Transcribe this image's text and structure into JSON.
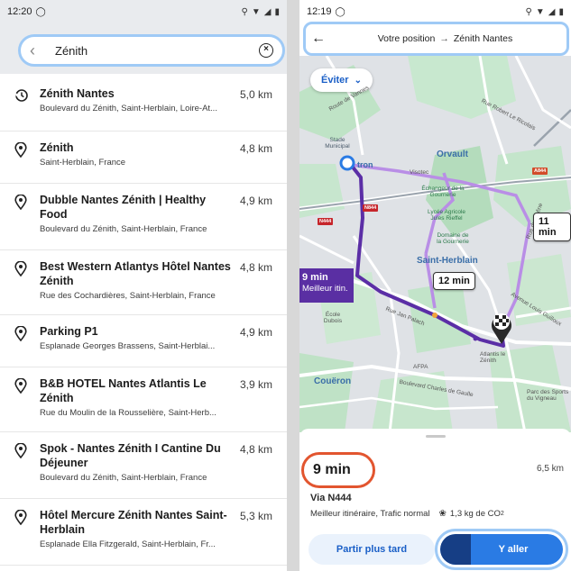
{
  "left": {
    "status": {
      "time": "12:20"
    },
    "search": {
      "query": "Zénith"
    },
    "results": [
      {
        "icon": "history-icon",
        "title": "Zénith Nantes",
        "subtitle": "Boulevard du Zénith, Saint-Herblain, Loire-At...",
        "distance": "5,0 km"
      },
      {
        "icon": "pin-icon",
        "title": "Zénith",
        "subtitle": "Saint-Herblain, France",
        "distance": "4,8 km"
      },
      {
        "icon": "pin-icon",
        "title": "Dubble Nantes Zénith | Healthy Food",
        "subtitle": "Boulevard du Zénith, Saint-Herblain, France",
        "distance": "4,9 km"
      },
      {
        "icon": "pin-icon",
        "title": "Best Western Atlantys Hôtel Nantes Zénith",
        "subtitle": "Rue des Cochardières, Saint-Herblain, France",
        "distance": "4,8 km"
      },
      {
        "icon": "pin-icon",
        "title": "Parking P1",
        "subtitle": "Esplanade Georges Brassens, Saint-Herblai...",
        "distance": "4,9 km"
      },
      {
        "icon": "pin-icon",
        "title": "B&B HOTEL Nantes Atlantis Le Zénith",
        "subtitle": "Rue du Moulin de la Rousselière, Saint-Herb...",
        "distance": "3,9 km"
      },
      {
        "icon": "pin-icon",
        "title": "Spok - Nantes Zénith I Cantine Du Déjeuner",
        "subtitle": "Boulevard du Zénith, Saint-Herblain, France",
        "distance": "4,8 km"
      },
      {
        "icon": "pin-icon",
        "title": "Hôtel Mercure Zénith Nantes Saint-Herblain",
        "subtitle": "Esplanade Ella Fitzgerald, Saint-Herblain, Fr...",
        "distance": "5,3 km"
      }
    ]
  },
  "right": {
    "status": {
      "time": "12:19"
    },
    "route": {
      "from": "Votre position",
      "to": "Zénith Nantes"
    },
    "map": {
      "avoid_label": "Éviter",
      "alt_route_1": "11 min",
      "alt_route_2": "12 min",
      "best_time": "9 min",
      "best_label": "Meilleur itin.",
      "labels": {
        "stade": "Stade Municipal",
        "orvault": "Orvault",
        "tron": "tron",
        "visotec": "Visotec",
        "echangeur": "Échangeur de la Gournerie",
        "lycee": "Lycée Agricole Jules Rieffel",
        "domaine": "Domaine de la Gournerie",
        "saint_herblain": "Saint-Herblain",
        "couëron": "Couëron",
        "ecole": "École Dubois",
        "atlantis": "Atlantis le Zénith",
        "afpa": "AFPA",
        "sports": "Parc des Sports du Vigneau",
        "route_vannes": "Route de Vannes",
        "rue_pelloch": "Rue Jan Palach",
        "rue_robert": "Rue Robert Le Ricolais",
        "bd_gaulle": "Boulevard Charles de Gaulle",
        "bd_guilloux": "Avenue Louis Guilloux",
        "rue_chene": "Rue du Chêne",
        "n444_a": "N444",
        "n444_b": "N444",
        "n844": "N844",
        "a844": "A844"
      }
    },
    "summary": {
      "duration": "9 min",
      "distance": "6,5 km",
      "via": "Via N444",
      "details": "Meilleur itinéraire, Trafic normal",
      "co2": "1,3 kg de CO",
      "co2_sub": "2",
      "later_button": "Partir plus tard",
      "go_button": "Y aller",
      "go_progress": 0.25
    }
  }
}
